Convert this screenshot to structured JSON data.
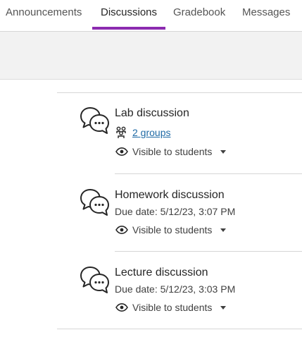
{
  "tabs": [
    {
      "label": "Announcements",
      "active": false
    },
    {
      "label": "Discussions",
      "active": true
    },
    {
      "label": "Gradebook",
      "active": false
    },
    {
      "label": "Messages",
      "active": false
    }
  ],
  "accent_color": "#8c2bb0",
  "discussions": [
    {
      "title": "Lab discussion",
      "groups_link": "2 groups",
      "visibility": "Visible to students"
    },
    {
      "title": "Homework discussion",
      "due": "Due date: 5/12/23, 3:07 PM",
      "visibility": "Visible to students"
    },
    {
      "title": "Lecture discussion",
      "due": "Due date: 5/12/23, 3:03 PM",
      "visibility": "Visible to students"
    }
  ],
  "icons": {
    "discussion": "discussion-bubbles-icon",
    "groups": "groups-icon",
    "visibility": "eye-icon",
    "dropdown": "caret-down-icon"
  }
}
